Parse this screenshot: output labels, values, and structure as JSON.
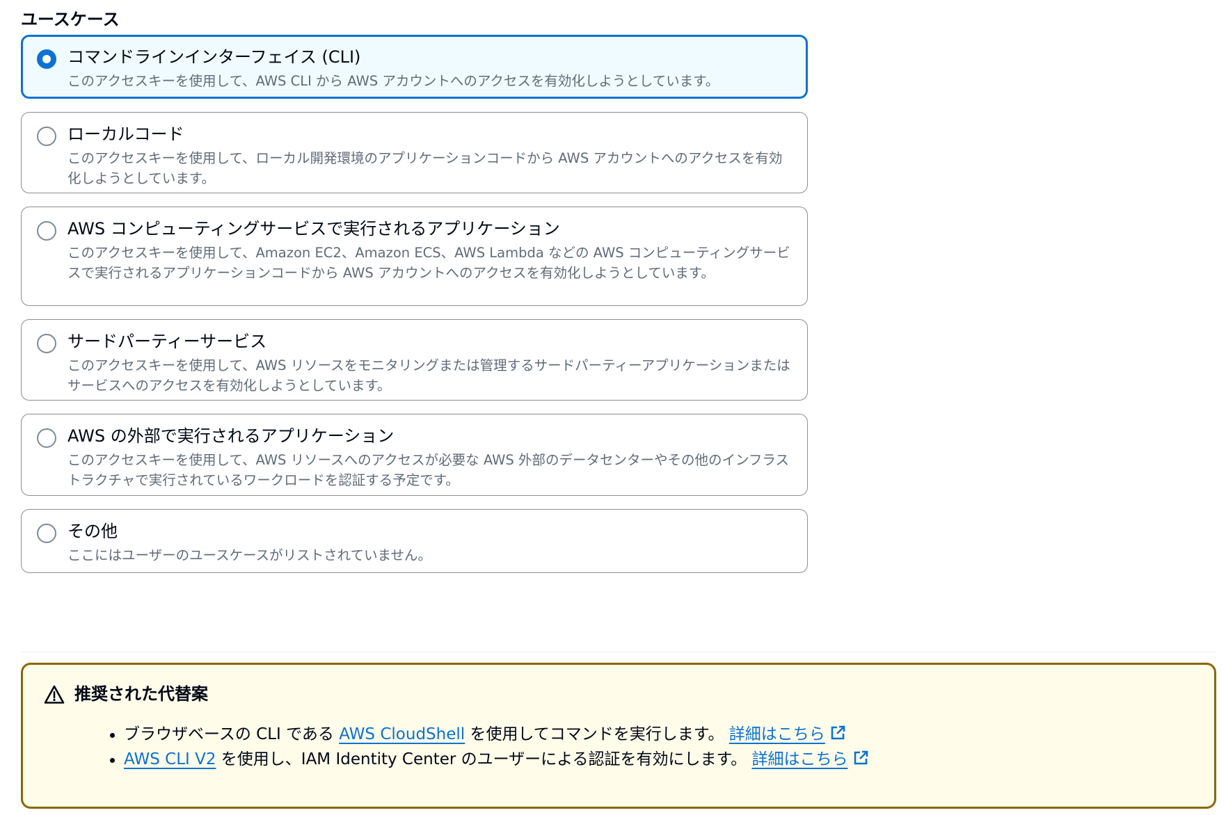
{
  "section": {
    "title": "ユースケース"
  },
  "options": [
    {
      "label": "コマンドラインインターフェイス (CLI)",
      "description": "このアクセスキーを使用して、AWS CLI から AWS アカウントへのアクセスを有効化しようとしています。",
      "selected": true
    },
    {
      "label": "ローカルコード",
      "description": "このアクセスキーを使用して、ローカル開発環境のアプリケーションコードから AWS アカウントへのアクセスを有効化しようとしています。",
      "selected": false
    },
    {
      "label": "AWS コンピューティングサービスで実行されるアプリケーション",
      "description": "このアクセスキーを使用して、Amazon EC2、Amazon ECS、AWS Lambda などの AWS コンピューティングサービスで実行されるアプリケーションコードから AWS アカウントへのアクセスを有効化しようとしています。",
      "selected": false
    },
    {
      "label": "サードパーティーサービス",
      "description": "このアクセスキーを使用して、AWS リソースをモニタリングまたは管理するサードパーティーアプリケーションまたはサービスへのアクセスを有効化しようとしています。",
      "selected": false
    },
    {
      "label": "AWS の外部で実行されるアプリケーション",
      "description": "このアクセスキーを使用して、AWS リソースへのアクセスが必要な AWS 外部のデータセンターやその他のインフラストラクチャで実行されているワークロードを認証する予定です。",
      "selected": false
    },
    {
      "label": "その他",
      "description": "ここにはユーザーのユースケースがリストされていません。",
      "selected": false
    }
  ],
  "alert": {
    "icon": "warning-icon",
    "title": "推奨された代替案",
    "border_color": "#8d6605",
    "background_color": "#fffce9",
    "items": [
      {
        "prefix": "ブラウザベースの CLI である ",
        "link_text": "AWS CloudShell",
        "suffix": " を使用してコマンドを実行します。 ",
        "learn_more": "詳細はこちら",
        "learn_more_icon": "external-link-icon"
      },
      {
        "prefix": "",
        "link_text": "AWS CLI V2",
        "suffix": " を使用し、IAM Identity Center のユーザーによる認証を有効にします。 ",
        "learn_more": "詳細はこちら",
        "learn_more_icon": "external-link-icon"
      }
    ]
  },
  "colors": {
    "accent": "#0972d3",
    "selected_background": "#f0fbff",
    "text": "#000716",
    "secondary_text": "#5f6b7a"
  }
}
